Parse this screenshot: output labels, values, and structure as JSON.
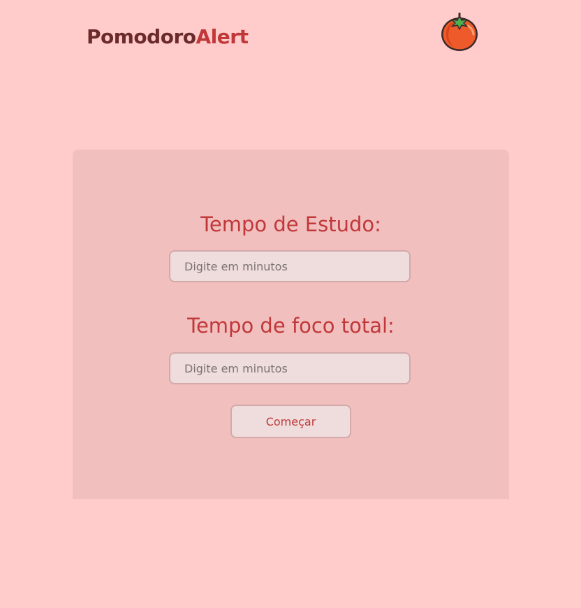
{
  "header": {
    "logo_part1": "Pomodoro",
    "logo_part2": "Alert",
    "logo_icon": "tomato-icon"
  },
  "form": {
    "study_label": "Tempo de Estudo:",
    "study_placeholder": "Digite em minutos",
    "focus_label": "Tempo de foco total:",
    "focus_placeholder": "Digite em minutos",
    "start_button": "Começar"
  },
  "colors": {
    "background": "#ffcccb",
    "card": "#f2bfbf",
    "accent": "#c0383a",
    "logo_dark": "#6b2a2b"
  }
}
